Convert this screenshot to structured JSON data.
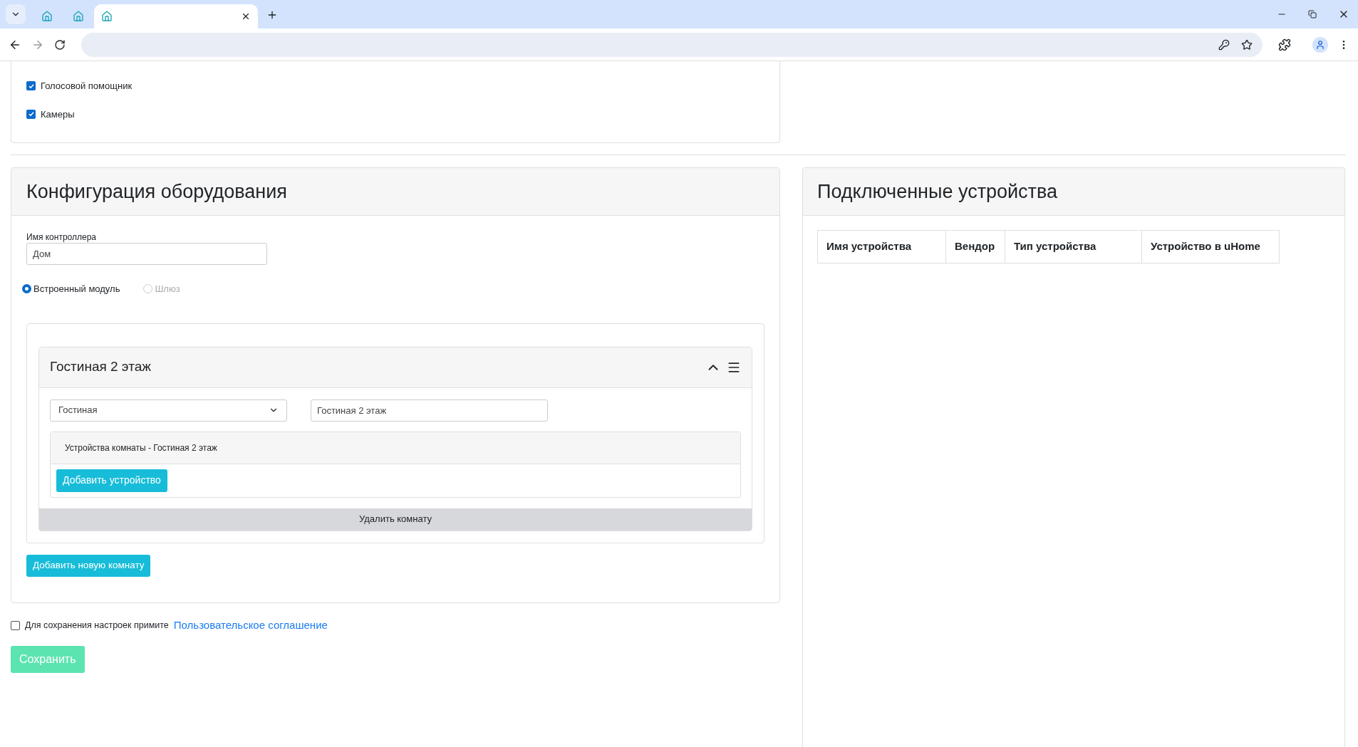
{
  "browser": {
    "tabs": [
      {
        "selected": false
      },
      {
        "selected": false
      },
      {
        "selected": true
      }
    ]
  },
  "features": [
    {
      "label": "Голосовой помощник",
      "checked": true
    },
    {
      "label": "Камеры",
      "checked": true
    }
  ],
  "config": {
    "title": "Конфигурация оборудования",
    "controller_label": "Имя контроллера",
    "controller_value": "Дом",
    "radios": [
      {
        "label": "Встроенный модуль",
        "selected": true,
        "disabled": false
      },
      {
        "label": "Шлюз",
        "selected": false,
        "disabled": true
      }
    ],
    "rooms": [
      {
        "title": "Гостиная 2 этаж",
        "expanded": true,
        "type_value": "Гостиная",
        "name_value": "Гостиная 2 этаж",
        "devices_title": "Устройства комнаты - Гостиная 2 этаж",
        "add_device_button": "Добавить устройство",
        "delete_button": "Удалить комнату"
      }
    ],
    "add_room_button": "Добавить новую комнату"
  },
  "agreement": {
    "text": "Для сохранения настроек примите",
    "link": "Пользовательское соглашение",
    "checked": false
  },
  "save_button": {
    "label": "Сохранить",
    "disabled": true
  },
  "devices": {
    "title": "Подключенные устройства",
    "columns": [
      "Имя устройства",
      "Вендор",
      "Тип устройства",
      "Устройство в uHome"
    ]
  }
}
